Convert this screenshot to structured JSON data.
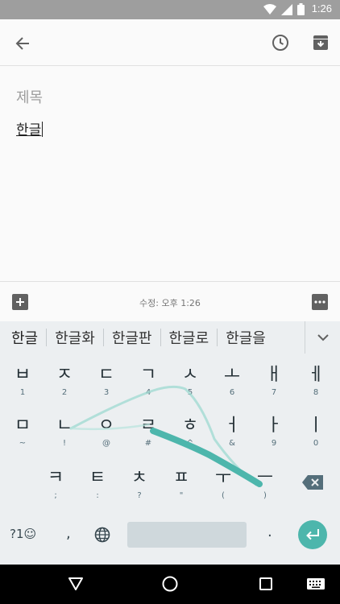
{
  "status": {
    "time": "1:26",
    "icons": [
      "wifi-icon",
      "signal-icon",
      "battery-icon"
    ]
  },
  "app_bar": {
    "icons": [
      "back-arrow-icon",
      "reminder-clock-icon",
      "archive-icon"
    ]
  },
  "note": {
    "title_placeholder": "제목",
    "body": "한글"
  },
  "bottom_bar": {
    "edited_text": "수정: 오후 1:26",
    "icons": [
      "add-icon",
      "more-options-icon"
    ]
  },
  "suggestions": [
    "한글",
    "한글화",
    "한글판",
    "한글로",
    "한글을"
  ],
  "keyboard": {
    "row1": [
      {
        "k": "ㅂ",
        "s": "1"
      },
      {
        "k": "ㅈ",
        "s": "2"
      },
      {
        "k": "ㄷ",
        "s": "3"
      },
      {
        "k": "ㄱ",
        "s": "4"
      },
      {
        "k": "ㅅ",
        "s": "5"
      },
      {
        "k": "ㅗ",
        "s": "6"
      },
      {
        "k": "ㅐ",
        "s": "7"
      },
      {
        "k": "ㅔ",
        "s": "8"
      }
    ],
    "row2": [
      {
        "k": "ㅁ",
        "s": "~"
      },
      {
        "k": "ㄴ",
        "s": "!"
      },
      {
        "k": "ㅇ",
        "s": "@"
      },
      {
        "k": "ㄹ",
        "s": "#"
      },
      {
        "k": "ㅎ",
        "s": "^"
      },
      {
        "k": "ㅓ",
        "s": "&"
      },
      {
        "k": "ㅏ",
        "s": "9"
      },
      {
        "k": "ㅣ",
        "s": "0"
      }
    ],
    "row3": [
      {
        "k": "ㅋ",
        "s": ";"
      },
      {
        "k": "ㅌ",
        "s": ":"
      },
      {
        "k": "ㅊ",
        "s": "?"
      },
      {
        "k": "ㅍ",
        "s": "\""
      },
      {
        "k": "ㅜ",
        "s": "("
      },
      {
        "k": "ㅡ",
        "s": ")"
      }
    ],
    "symbols_label": "?1☺",
    "comma": ",",
    "period": "."
  },
  "nav_bar": {
    "icons": [
      "back-triangle-icon",
      "home-circle-icon",
      "recents-square-icon",
      "keyboard-switch-icon"
    ]
  },
  "colors": {
    "accent": "#4db6ac",
    "status_bar": "#9e9e9e",
    "keyboard_bg": "#eceff1"
  }
}
